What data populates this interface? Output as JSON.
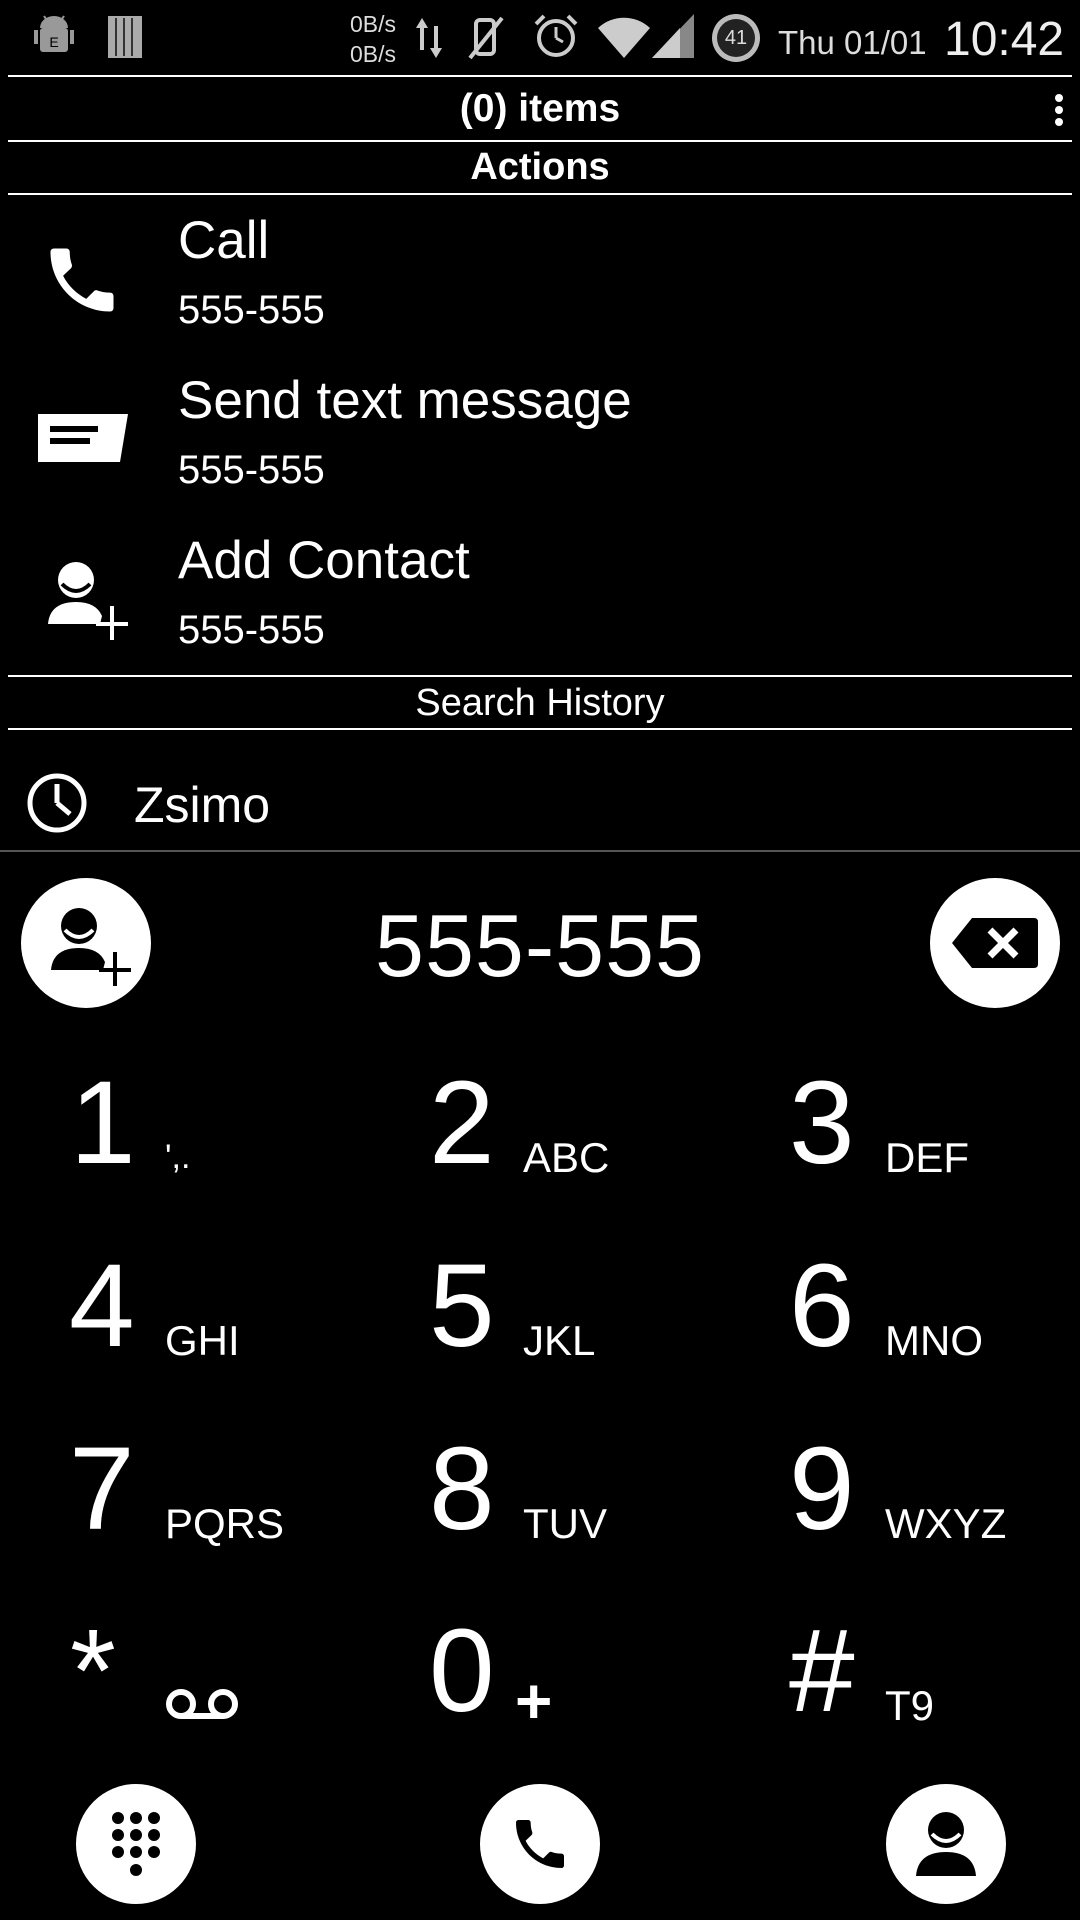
{
  "status_bar": {
    "net_up": "0B/s",
    "net_down": "0B/s",
    "battery_level": "41",
    "date": "Thu 01/01",
    "time": "10:42",
    "icons": [
      "android-debug-icon",
      "sim-card-icon",
      "data-arrows-icon",
      "mute-icon",
      "alarm-icon",
      "wifi-icon",
      "signal-icon",
      "battery-icon"
    ]
  },
  "header": {
    "title": "(0) items",
    "menu_icon": "overflow-menu-icon"
  },
  "actions": {
    "heading": "Actions",
    "items": [
      {
        "label": "Call",
        "number": "555-555",
        "icon": "phone-icon"
      },
      {
        "label": "Send text message",
        "number": "555-555",
        "icon": "message-icon"
      },
      {
        "label": "Add Contact",
        "number": "555-555",
        "icon": "add-contact-icon"
      }
    ]
  },
  "search_history": {
    "heading": "Search History",
    "items": [
      {
        "label": "Zsimo",
        "icon": "clock-icon"
      }
    ]
  },
  "dialer": {
    "entered_number": "555-555",
    "keys": [
      {
        "digit": "1",
        "letters": "',."
      },
      {
        "digit": "2",
        "letters": "ABC"
      },
      {
        "digit": "3",
        "letters": "DEF"
      },
      {
        "digit": "4",
        "letters": "GHI"
      },
      {
        "digit": "5",
        "letters": "JKL"
      },
      {
        "digit": "6",
        "letters": "MNO"
      },
      {
        "digit": "7",
        "letters": "PQRS"
      },
      {
        "digit": "8",
        "letters": "TUV"
      },
      {
        "digit": "9",
        "letters": "WXYZ"
      },
      {
        "digit": "*",
        "letters": "voicemail-icon"
      },
      {
        "digit": "0",
        "letters": "+"
      },
      {
        "digit": "#",
        "letters": "T9"
      }
    ]
  },
  "bottom_bar": {
    "buttons": [
      "dialpad-icon",
      "call-icon",
      "contacts-icon"
    ]
  },
  "colors": {
    "background": "#000000",
    "foreground": "#ffffff",
    "divider": "#ffffff"
  }
}
